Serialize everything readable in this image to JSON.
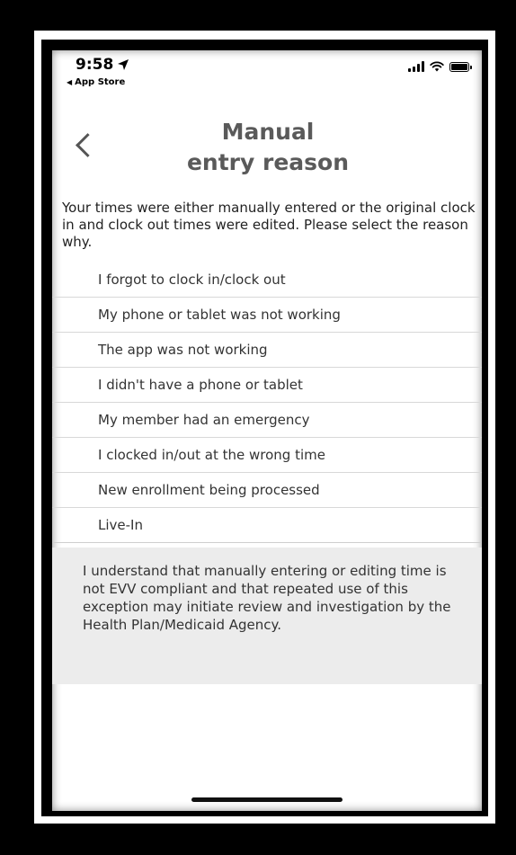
{
  "status_bar": {
    "time": "9:58",
    "back_app_label": "App Store"
  },
  "header": {
    "title_line1": "Manual",
    "title_line2": "entry reason"
  },
  "intro_text": "Your times were either manually entered or the original clock in and clock out times were edited. Please select the reason why.",
  "options": [
    "I forgot to clock in/clock out",
    "My phone or tablet was not working",
    "The app was not working",
    "I didn't have a phone or tablet",
    "My member had an emergency",
    "I clocked in/out at the wrong time",
    "New enrollment being processed",
    "Live-In"
  ],
  "disclaimer": "I understand that manually entering or editing time is not EVV compliant and that repeated use of this exception may initiate review and investigation by the Health Plan/Medicaid Agency.",
  "colors": {
    "title": "#5a5a5a",
    "disclaimer_bg": "#ececec",
    "divider": "#d8d8d8"
  }
}
